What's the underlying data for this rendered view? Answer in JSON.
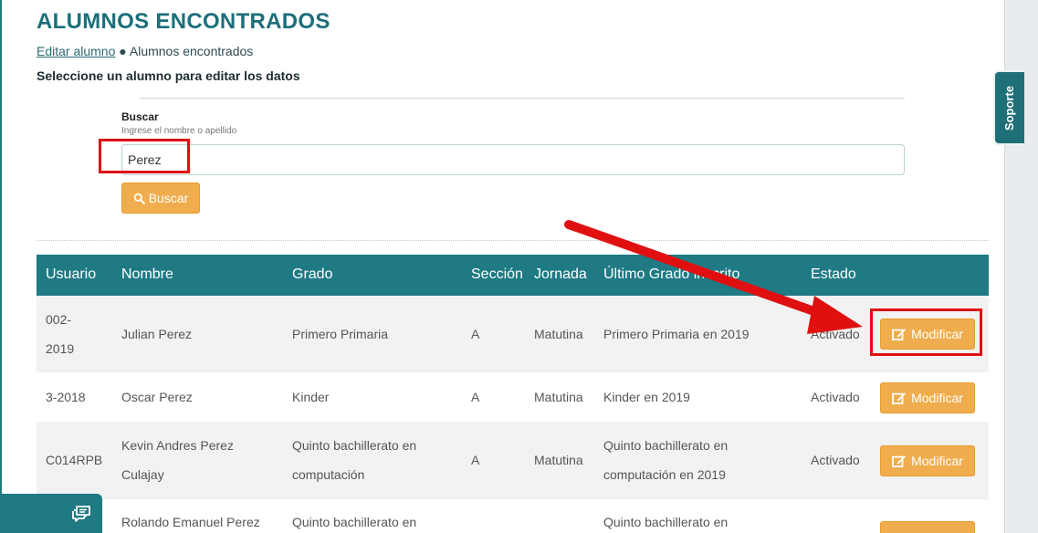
{
  "page": {
    "title": "ALUMNOS ENCONTRADOS",
    "breadcrumb": {
      "link": "Editar alumno",
      "separator": "●",
      "current": "Alumnos encontrados"
    },
    "subtitle": "Seleccione un alumno para editar los datos"
  },
  "search": {
    "label": "Buscar",
    "help": "Ingrese el nombre o apellido",
    "value": "Perez",
    "button_label": "Buscar"
  },
  "table": {
    "headers": [
      "Usuario",
      "Nombre",
      "Grado",
      "Sección",
      "Jornada",
      "Último Grado inscrito",
      "Estado"
    ],
    "action_label": "Modificar",
    "rows": [
      {
        "usuario": "002-2019",
        "nombre": "Julian Perez",
        "grado": "Primero Primaria",
        "seccion": "A",
        "jornada": "Matutina",
        "ultimo": "Primero Primaria en 2019",
        "estado": "Activado"
      },
      {
        "usuario": "3-2018",
        "nombre": "Oscar Perez",
        "grado": "Kinder",
        "seccion": "A",
        "jornada": "Matutina",
        "ultimo": "Kinder en 2019",
        "estado": "Activado"
      },
      {
        "usuario": "C014RPB",
        "nombre": "Kevin Andres Perez Culajay",
        "grado": "Quinto bachillerato en computación",
        "seccion": "A",
        "jornada": "Matutina",
        "ultimo": "Quinto bachillerato en computación en 2019",
        "estado": "Activado"
      },
      {
        "usuario": "",
        "nombre": "Rolando Emanuel Perez",
        "grado": "Quinto bachillerato en",
        "seccion": "",
        "jornada": "",
        "ultimo": "Quinto bachillerato en",
        "estado": ""
      }
    ]
  },
  "support": {
    "label": "Soporte"
  },
  "colors": {
    "primary": "#1f7a84",
    "warning": "#f0ad4e",
    "annotation": "#e01010"
  },
  "icons": {
    "search": "search-icon",
    "edit": "edit-icon",
    "chat": "chat-icon"
  }
}
